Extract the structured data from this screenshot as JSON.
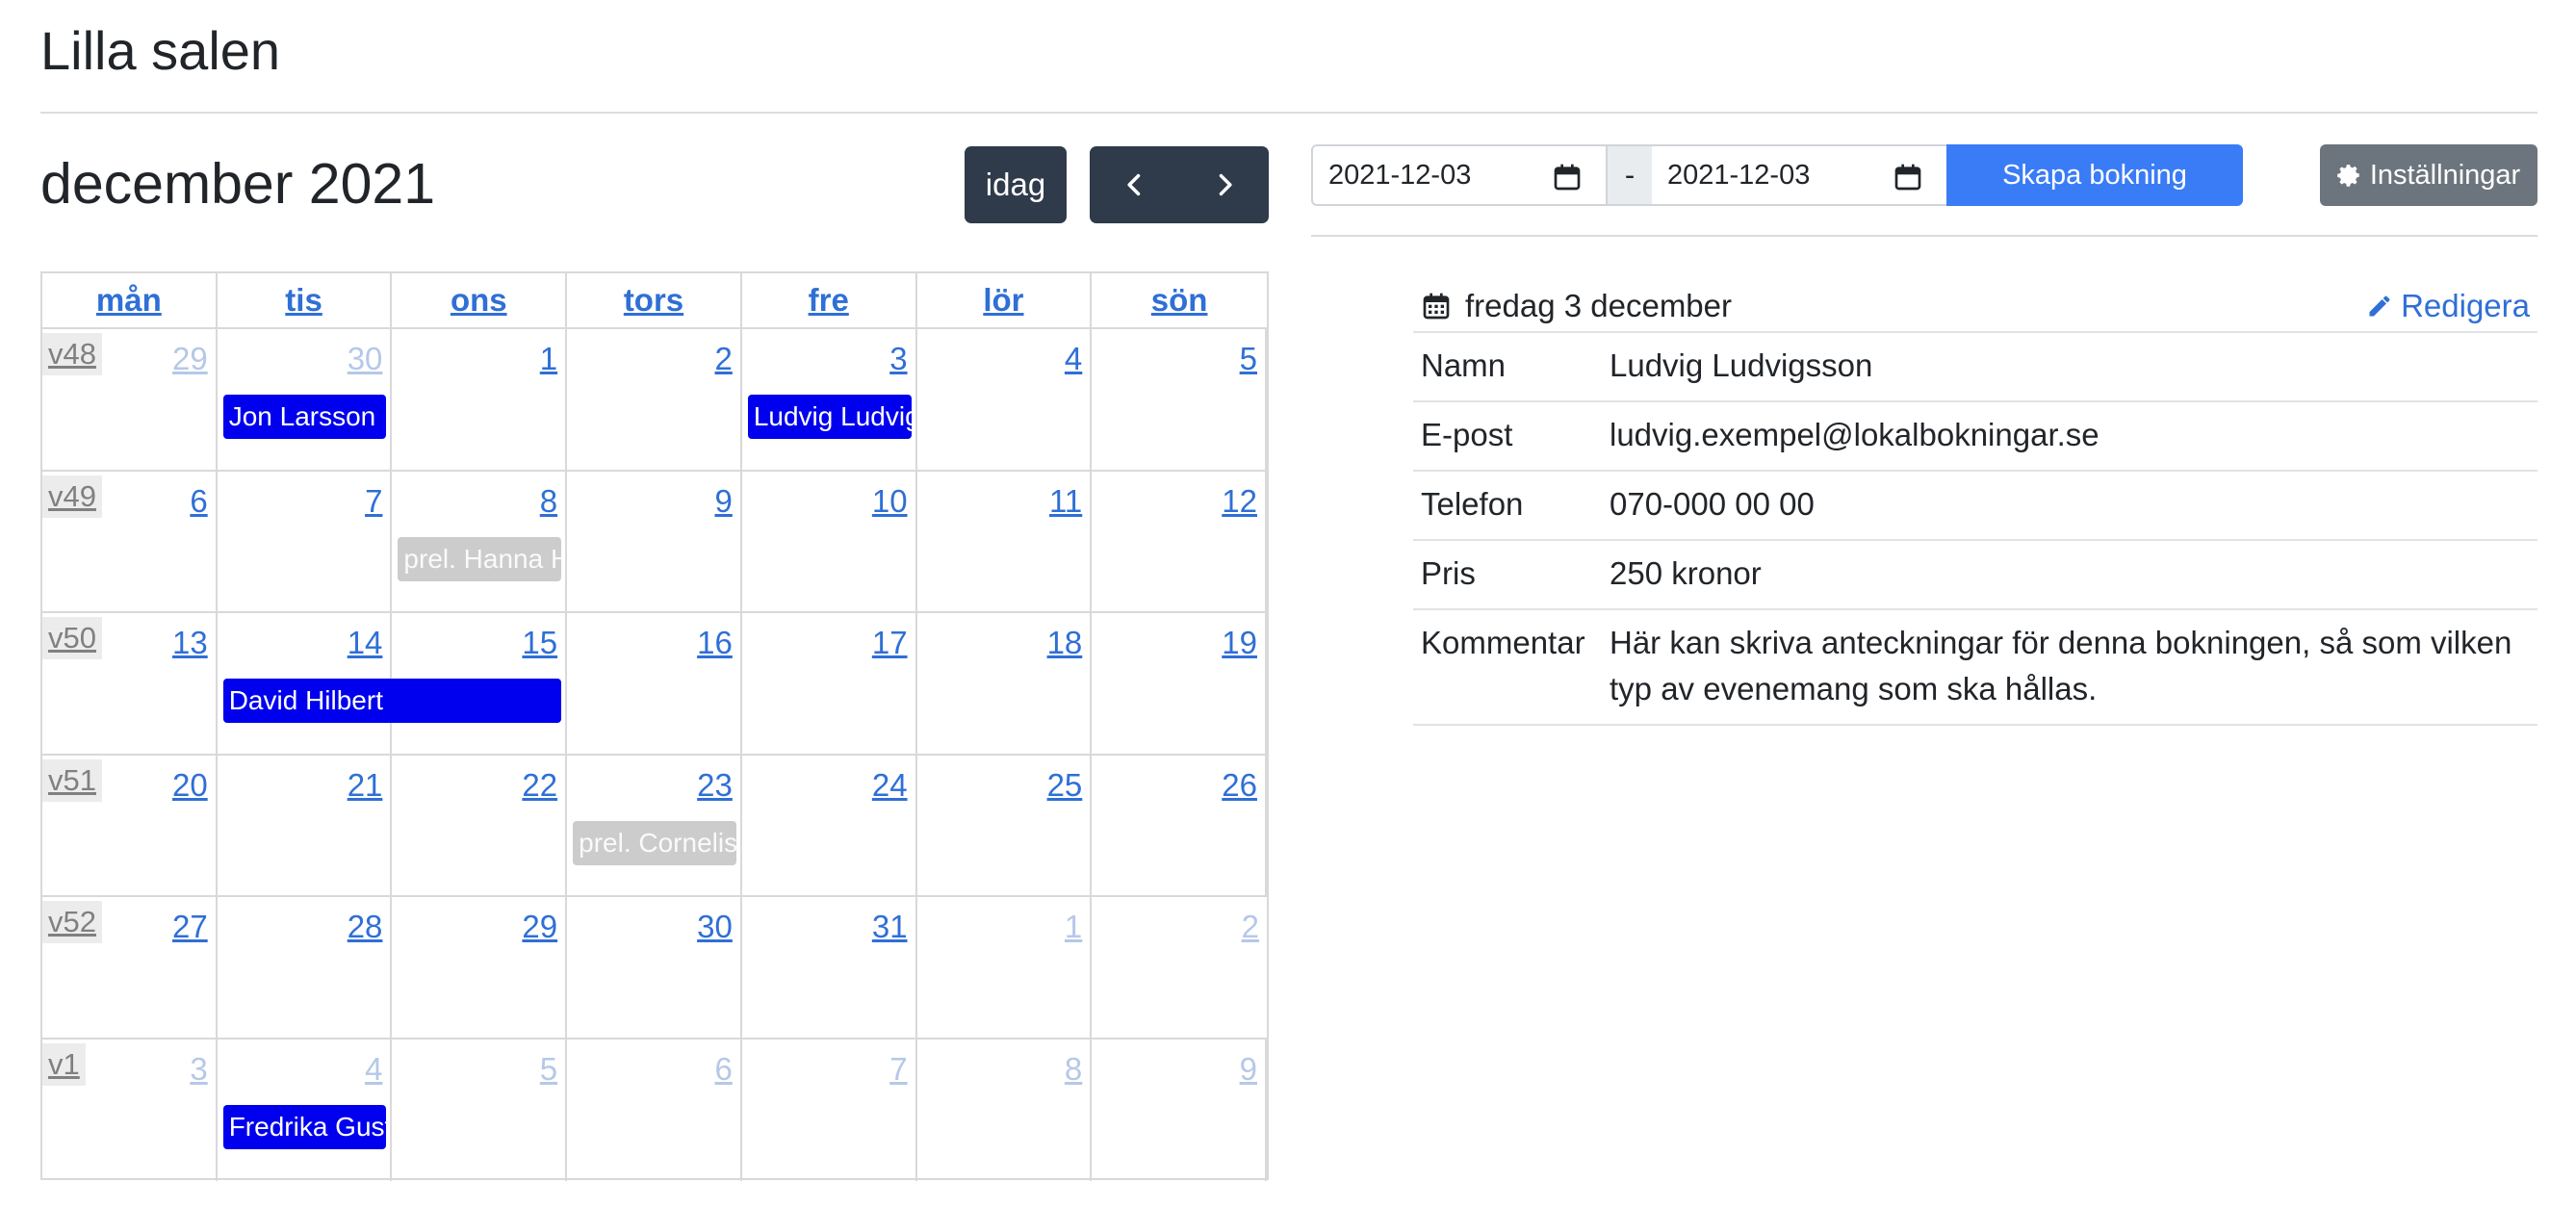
{
  "page_title": "Lilla salen",
  "calendar": {
    "month_title": "december 2021",
    "today_label": "idag",
    "weekdays": [
      "mån",
      "tis",
      "ons",
      "tors",
      "fre",
      "lör",
      "sön"
    ],
    "weeks": [
      {
        "week": "v48",
        "days": [
          {
            "n": "29",
            "muted": true
          },
          {
            "n": "30",
            "muted": true
          },
          {
            "n": "1"
          },
          {
            "n": "2"
          },
          {
            "n": "3"
          },
          {
            "n": "4"
          },
          {
            "n": "5"
          }
        ]
      },
      {
        "week": "v49",
        "days": [
          {
            "n": "6"
          },
          {
            "n": "7"
          },
          {
            "n": "8"
          },
          {
            "n": "9"
          },
          {
            "n": "10"
          },
          {
            "n": "11"
          },
          {
            "n": "12"
          }
        ]
      },
      {
        "week": "v50",
        "days": [
          {
            "n": "13"
          },
          {
            "n": "14"
          },
          {
            "n": "15"
          },
          {
            "n": "16"
          },
          {
            "n": "17"
          },
          {
            "n": "18"
          },
          {
            "n": "19"
          }
        ]
      },
      {
        "week": "v51",
        "days": [
          {
            "n": "20"
          },
          {
            "n": "21"
          },
          {
            "n": "22"
          },
          {
            "n": "23"
          },
          {
            "n": "24"
          },
          {
            "n": "25"
          },
          {
            "n": "26"
          }
        ]
      },
      {
        "week": "v52",
        "days": [
          {
            "n": "27"
          },
          {
            "n": "28"
          },
          {
            "n": "29"
          },
          {
            "n": "30"
          },
          {
            "n": "31"
          },
          {
            "n": "1",
            "muted": true
          },
          {
            "n": "2",
            "muted": true
          }
        ]
      },
      {
        "week": "v1",
        "days": [
          {
            "n": "3",
            "muted": true
          },
          {
            "n": "4",
            "muted": true
          },
          {
            "n": "5",
            "muted": true
          },
          {
            "n": "6",
            "muted": true
          },
          {
            "n": "7",
            "muted": true
          },
          {
            "n": "8",
            "muted": true
          },
          {
            "n": "9",
            "muted": true
          }
        ]
      }
    ],
    "events": [
      {
        "label": "Jon Larsson",
        "status": "confirmed",
        "week_index": 0,
        "day_index": 1,
        "span_days": 1
      },
      {
        "label": "Ludvig Ludvigsson",
        "status": "confirmed",
        "week_index": 0,
        "day_index": 4,
        "span_days": 1
      },
      {
        "label": "prel. Hanna H",
        "status": "preliminary",
        "week_index": 1,
        "day_index": 2,
        "span_days": 1
      },
      {
        "label": "David Hilbert",
        "status": "confirmed",
        "week_index": 2,
        "day_index": 1,
        "span_days": 2
      },
      {
        "label": "prel. Cornelis",
        "status": "preliminary",
        "week_index": 3,
        "day_index": 3,
        "span_days": 1
      },
      {
        "label": "Fredrika Gustafsson",
        "status": "confirmed",
        "week_index": 5,
        "day_index": 1,
        "span_days": 1
      }
    ],
    "colors": {
      "confirmed": "#0000ee",
      "preliminary": "#cccccc",
      "link": "#2f6fd6"
    }
  },
  "booking_form": {
    "date_from": "2021-12-03",
    "date_separator": "-",
    "date_to": "2021-12-03",
    "create_label": "Skapa bokning",
    "settings_label": "Inställningar"
  },
  "detail": {
    "heading": "fredag 3 december",
    "edit_label": "Redigera",
    "rows": [
      {
        "key": "Namn",
        "value": "Ludvig Ludvigsson"
      },
      {
        "key": "E-post",
        "value": "ludvig.exempel@lokalbokningar.se"
      },
      {
        "key": "Telefon",
        "value": "070-000 00 00"
      },
      {
        "key": "Pris",
        "value": "250 kronor"
      },
      {
        "key": "Kommentar",
        "value": "Här kan skriva anteckningar för denna bokningen, så som vilken typ av evenemang som ska hållas."
      }
    ]
  },
  "icons": [
    "chevron-left-icon",
    "chevron-right-icon",
    "calendar-icon",
    "gear-icon",
    "pencil-icon"
  ]
}
